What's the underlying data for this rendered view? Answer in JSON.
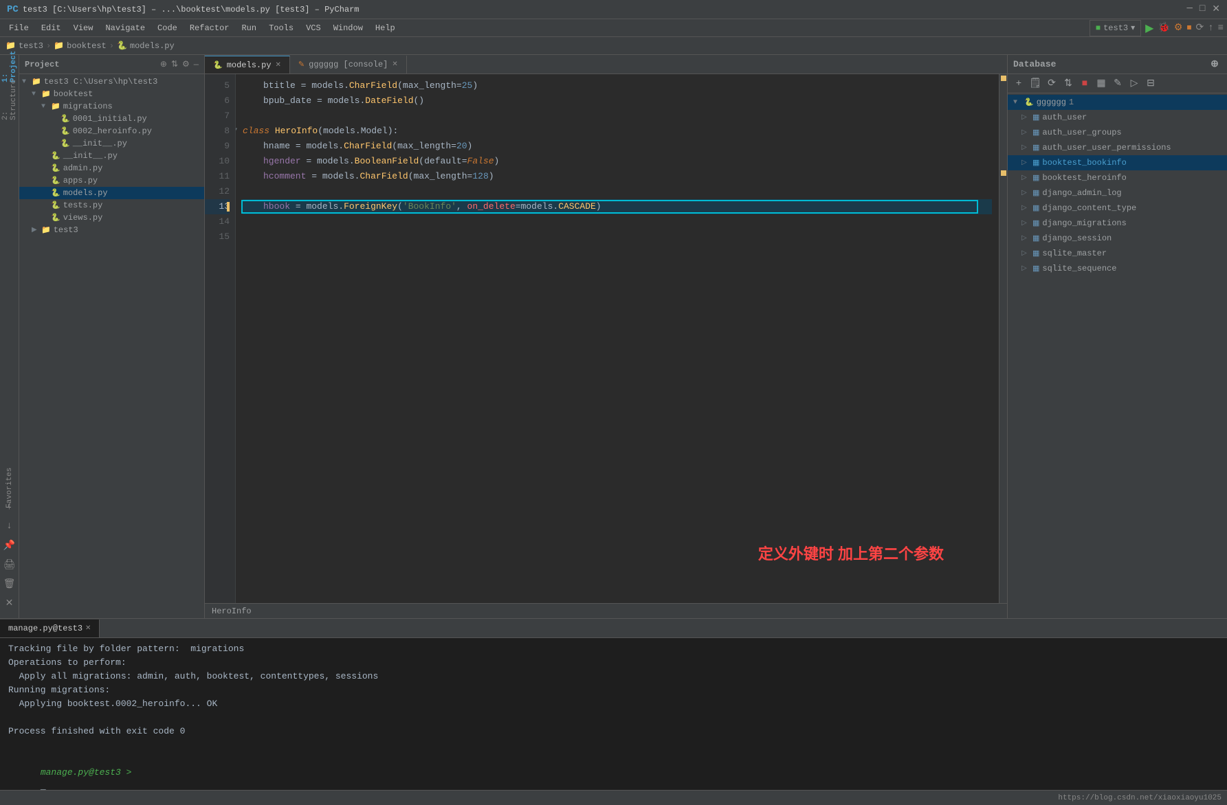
{
  "window": {
    "title": "test3 [C:\\Users\\hp\\test3] – ...\\booktest\\models.py [test3] – PyCharm",
    "favicon": "PyCharm"
  },
  "menu": {
    "items": [
      "File",
      "Edit",
      "View",
      "Navigate",
      "Code",
      "Refactor",
      "Run",
      "Tools",
      "VCS",
      "Window",
      "Help"
    ]
  },
  "breadcrumb": {
    "items": [
      "test3",
      "booktest",
      "models.py"
    ]
  },
  "project_panel": {
    "title": "Project",
    "root": {
      "name": "test3",
      "path": "C:\\Users\\hp\\test3",
      "children": [
        {
          "name": "booktest",
          "type": "folder",
          "expanded": true,
          "children": [
            {
              "name": "migrations",
              "type": "folder",
              "expanded": true
            },
            {
              "name": "0001_initial.py",
              "type": "python"
            },
            {
              "name": "0002_heroinfo.py",
              "type": "python"
            },
            {
              "name": "__init__.py",
              "type": "python"
            },
            {
              "name": "__init__.py",
              "type": "python"
            },
            {
              "name": "admin.py",
              "type": "python"
            },
            {
              "name": "apps.py",
              "type": "python"
            },
            {
              "name": "models.py",
              "type": "python",
              "selected": true
            },
            {
              "name": "tests.py",
              "type": "python"
            },
            {
              "name": "views.py",
              "type": "python"
            }
          ]
        },
        {
          "name": "test3",
          "type": "folder"
        }
      ]
    }
  },
  "tabs": {
    "active": "models.py",
    "items": [
      {
        "label": "models.py",
        "icon": "python",
        "closable": true,
        "modified": false
      },
      {
        "label": "gggggg [console]",
        "icon": "console",
        "closable": true,
        "modified": true
      }
    ]
  },
  "code": {
    "lines": [
      {
        "num": 5,
        "content_html": "    <span class='var2'>btitle</span> <span class='eq'>=</span> <span class='cls'>models</span>.<span class='func'>CharField</span>(<span class='param'>max_length</span>=<span class='num'>25</span>)"
      },
      {
        "num": 6,
        "content_html": "    <span class='var2'>bpub_date</span> <span class='eq'>=</span> <span class='cls'>models</span>.<span class='func'>DateField</span>()"
      },
      {
        "num": 7,
        "content_html": ""
      },
      {
        "num": 8,
        "content_html": "<span class='kw'>class</span> <span class='cls'>HeroInfo</span>(<span class='cls'>models</span>.<span class='cls'>Model</span>):",
        "has_fold": true
      },
      {
        "num": 9,
        "content_html": "    <span class='var2'>hname</span> <span class='eq'>=</span> <span class='cls'>models</span>.<span class='func'>CharField</span>(<span class='param'>max_length</span>=<span class='num'>20</span>)"
      },
      {
        "num": 10,
        "content_html": "    <span class='var'>hgender</span> <span class='eq'>=</span> <span class='cls'>models</span>.<span class='func'>BooleanField</span>(<span class='param'>default</span>=<span class='kw'>False</span>)"
      },
      {
        "num": 11,
        "content_html": "    <span class='var'>hcomment</span> <span class='eq'>=</span> <span class='cls'>models</span>.<span class='func'>CharField</span>(<span class='param'>max_length</span>=<span class='num'>128</span>)"
      },
      {
        "num": 12,
        "content_html": ""
      },
      {
        "num": 13,
        "content_html": "    <span class='var'>hbook</span> <span class='eq'>=</span> <span class='cls'>models</span>.<span class='func'>ForeignKey</span>(<span class='str'>'BookInfo'</span>, <span class='red-text'>on_delete</span>=<span class='cls'>models</span>.<span class='func'>CASCADE</span>)",
        "highlighted": true
      },
      {
        "num": 14,
        "content_html": ""
      },
      {
        "num": 15,
        "content_html": ""
      }
    ],
    "annotation": "定义外键时  加上第二个参数",
    "breadcrumb_bottom": "HeroInfo"
  },
  "database_panel": {
    "title": "Database",
    "schema_name": "gggggg",
    "schema_count": 1,
    "tables": [
      {
        "name": "auth_user",
        "level": 1
      },
      {
        "name": "auth_user_groups",
        "level": 1
      },
      {
        "name": "auth_user_user_permissions",
        "level": 1
      },
      {
        "name": "booktest_bookinfo",
        "level": 1,
        "selected": true
      },
      {
        "name": "booktest_heroinfo",
        "level": 1
      },
      {
        "name": "django_admin_log",
        "level": 1
      },
      {
        "name": "django_content_type",
        "level": 1
      },
      {
        "name": "django_migrations",
        "level": 1
      },
      {
        "name": "django_session",
        "level": 1
      },
      {
        "name": "sqlite_master",
        "level": 1
      },
      {
        "name": "sqlite_sequence",
        "level": 1
      }
    ]
  },
  "terminal": {
    "tab_label": "manage.py@test3",
    "lines": [
      "Tracking file by folder pattern:  migrations",
      "Operations to perform:",
      "  Apply all migrations: admin, auth, booktest, contenttypes, sessions",
      "Running migrations:",
      "  Applying booktest.0002_heroinfo... OK",
      "",
      "Process finished with exit code 0",
      "",
      ""
    ],
    "prompt": "manage.py@test3 > "
  },
  "status_bar": {
    "url": "https://blog.csdn.net/xiaoxiaoyu1025"
  },
  "run_config": {
    "label": "test3",
    "icon": "run"
  },
  "toolbar_icons": {
    "run": "▶",
    "debug": "🐛",
    "build": "⚙",
    "profile": "📊"
  }
}
